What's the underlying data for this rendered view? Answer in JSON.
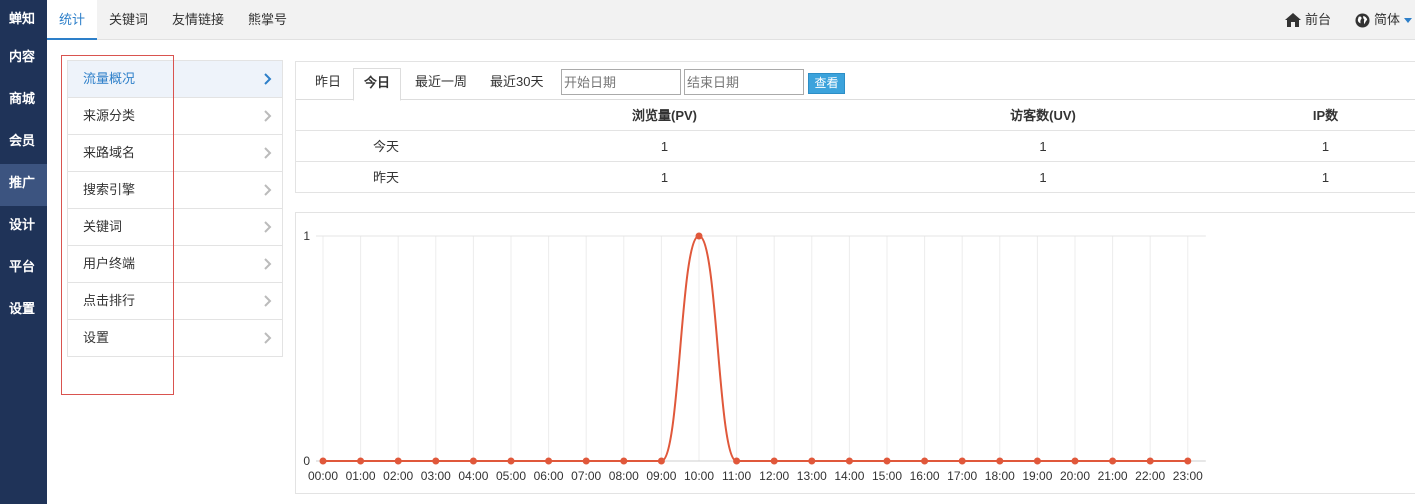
{
  "leftnav": {
    "items": [
      {
        "label": "蝉知"
      },
      {
        "label": "内容"
      },
      {
        "label": "商城"
      },
      {
        "label": "会员"
      },
      {
        "label": "推广"
      },
      {
        "label": "设计"
      },
      {
        "label": "平台"
      },
      {
        "label": "设置"
      }
    ],
    "active_index": 4
  },
  "topbar": {
    "tabs": [
      {
        "label": "统计"
      },
      {
        "label": "关键词"
      },
      {
        "label": "友情链接"
      },
      {
        "label": "熊掌号"
      }
    ],
    "frontend_label": "前台",
    "language_label": "简体"
  },
  "sidemenu": {
    "items": [
      {
        "label": "流量概况"
      },
      {
        "label": "来源分类"
      },
      {
        "label": "来路域名"
      },
      {
        "label": "搜索引擎"
      },
      {
        "label": "关键词"
      },
      {
        "label": "用户终端"
      },
      {
        "label": "点击排行"
      },
      {
        "label": "设置"
      }
    ]
  },
  "range_tabs": [
    {
      "label": "昨日"
    },
    {
      "label": "今日"
    },
    {
      "label": "最近一周"
    },
    {
      "label": "最近30天"
    }
  ],
  "date_filter": {
    "start_placeholder": "开始日期",
    "end_placeholder": "结束日期",
    "view_label": "查看"
  },
  "stats_table": {
    "headers": [
      "",
      "浏览量(PV)",
      "访客数(UV)",
      "IP数"
    ],
    "rows": [
      [
        "今天",
        "1",
        "1",
        "1"
      ],
      [
        "昨天",
        "1",
        "1",
        "1"
      ]
    ]
  },
  "colors": {
    "nav_bg": "#1f3358",
    "accent": "#2d7fc9",
    "series": "#e0583b",
    "highlight_box": "#d9534f"
  },
  "chart_data": {
    "type": "line",
    "x": [
      "00:00",
      "01:00",
      "02:00",
      "03:00",
      "04:00",
      "05:00",
      "06:00",
      "07:00",
      "08:00",
      "09:00",
      "10:00",
      "11:00",
      "12:00",
      "13:00",
      "14:00",
      "15:00",
      "16:00",
      "17:00",
      "18:00",
      "19:00",
      "20:00",
      "21:00",
      "22:00",
      "23:00"
    ],
    "series": [
      {
        "values": [
          0,
          0,
          0,
          0,
          0,
          0,
          0,
          0,
          0,
          0,
          1,
          0,
          0,
          0,
          0,
          0,
          0,
          0,
          0,
          0,
          0,
          0,
          0,
          0
        ]
      }
    ],
    "yticks": [
      "0",
      "1"
    ],
    "ylim": [
      0,
      1
    ],
    "grid": true,
    "smooth": true
  }
}
